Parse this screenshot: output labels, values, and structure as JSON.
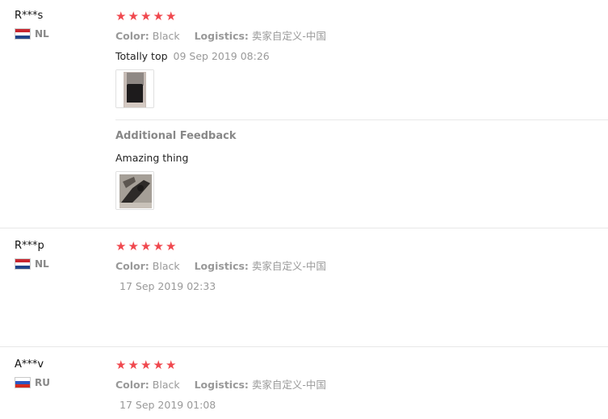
{
  "reviews": [
    {
      "user": "R***s",
      "country": "NL",
      "flag_colors": [
        "#c8262f",
        "#ffffff",
        "#21468b"
      ],
      "stars": 5,
      "color_label": "Color:",
      "color_value": "Black",
      "logistics_label": "Logistics:",
      "logistics_value": "卖家自定义-中国",
      "text": "Totally top",
      "date": "09 Sep 2019 08:26",
      "additional_title": "Additional Feedback",
      "additional_text": "Amazing thing"
    },
    {
      "user": "R***p",
      "country": "NL",
      "flag_colors": [
        "#c8262f",
        "#ffffff",
        "#21468b"
      ],
      "stars": 5,
      "color_label": "Color:",
      "color_value": "Black",
      "logistics_label": "Logistics:",
      "logistics_value": "卖家自定义-中国",
      "date": "17 Sep 2019 02:33"
    },
    {
      "user": "A***v",
      "country": "RU",
      "flag_colors": [
        "#ffffff",
        "#2b57c2",
        "#d52b1e"
      ],
      "stars": 5,
      "color_label": "Color:",
      "color_value": "Black",
      "logistics_label": "Logistics:",
      "logistics_value": "卖家自定义-中国",
      "date": "17 Sep 2019 01:08"
    }
  ],
  "colors": {
    "star": "#f0484e",
    "muted": "#999999",
    "divider": "#e8e8e8"
  }
}
